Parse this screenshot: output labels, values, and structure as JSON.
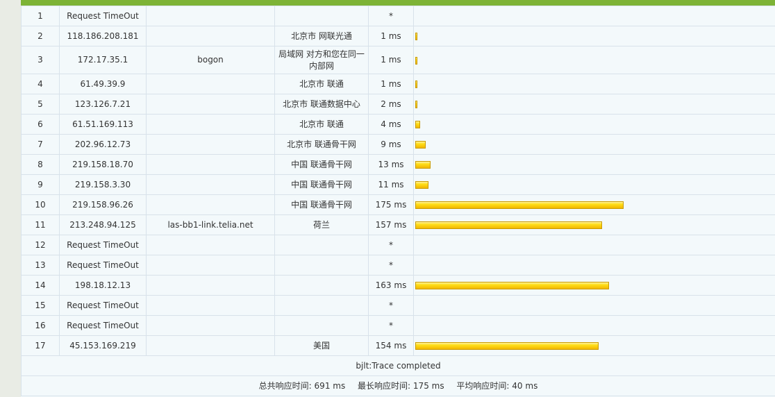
{
  "hops": [
    {
      "n": "1",
      "ip": "Request TimeOut",
      "host": "",
      "loc": "",
      "time": "*",
      "ms": null
    },
    {
      "n": "2",
      "ip": "118.186.208.181",
      "host": "",
      "loc": "北京市 网联光通",
      "time": "1 ms",
      "ms": 1
    },
    {
      "n": "3",
      "ip": "172.17.35.1",
      "host": "bogon",
      "loc": "局域网 对方和您在同一内部网",
      "time": "1 ms",
      "ms": 1
    },
    {
      "n": "4",
      "ip": "61.49.39.9",
      "host": "",
      "loc": "北京市 联通",
      "time": "1 ms",
      "ms": 1
    },
    {
      "n": "5",
      "ip": "123.126.7.21",
      "host": "",
      "loc": "北京市 联通数据中心",
      "time": "2 ms",
      "ms": 2
    },
    {
      "n": "6",
      "ip": "61.51.169.113",
      "host": "",
      "loc": "北京市 联通",
      "time": "4 ms",
      "ms": 4
    },
    {
      "n": "7",
      "ip": "202.96.12.73",
      "host": "",
      "loc": "北京市 联通骨干网",
      "time": "9 ms",
      "ms": 9
    },
    {
      "n": "8",
      "ip": "219.158.18.70",
      "host": "",
      "loc": "中国 联通骨干网",
      "time": "13 ms",
      "ms": 13
    },
    {
      "n": "9",
      "ip": "219.158.3.30",
      "host": "",
      "loc": "中国 联通骨干网",
      "time": "11 ms",
      "ms": 11
    },
    {
      "n": "10",
      "ip": "219.158.96.26",
      "host": "",
      "loc": "中国 联通骨干网",
      "time": "175 ms",
      "ms": 175
    },
    {
      "n": "11",
      "ip": "213.248.94.125",
      "host": "las-bb1-link.telia.net",
      "loc": "荷兰",
      "time": "157 ms",
      "ms": 157
    },
    {
      "n": "12",
      "ip": "Request TimeOut",
      "host": "",
      "loc": "",
      "time": "*",
      "ms": null
    },
    {
      "n": "13",
      "ip": "Request TimeOut",
      "host": "",
      "loc": "",
      "time": "*",
      "ms": null
    },
    {
      "n": "14",
      "ip": "198.18.12.13",
      "host": "",
      "loc": "",
      "time": "163 ms",
      "ms": 163
    },
    {
      "n": "15",
      "ip": "Request TimeOut",
      "host": "",
      "loc": "",
      "time": "*",
      "ms": null
    },
    {
      "n": "16",
      "ip": "Request TimeOut",
      "host": "",
      "loc": "",
      "time": "*",
      "ms": null
    },
    {
      "n": "17",
      "ip": "45.153.169.219",
      "host": "",
      "loc": "美国",
      "time": "154 ms",
      "ms": 154
    }
  ],
  "status": "bjlt:Trace completed",
  "summary": {
    "total_label": "总共响应时间:",
    "total_value": "691 ms",
    "max_label": "最长响应时间:",
    "max_value": "175 ms",
    "avg_label": "平均响应时间:",
    "avg_value": "40 ms"
  },
  "colors": {
    "header_bar": "#7db336",
    "bar_fill": "#ffd700",
    "bar_border": "#c99a00",
    "grid_line": "#d8e2ea"
  }
}
